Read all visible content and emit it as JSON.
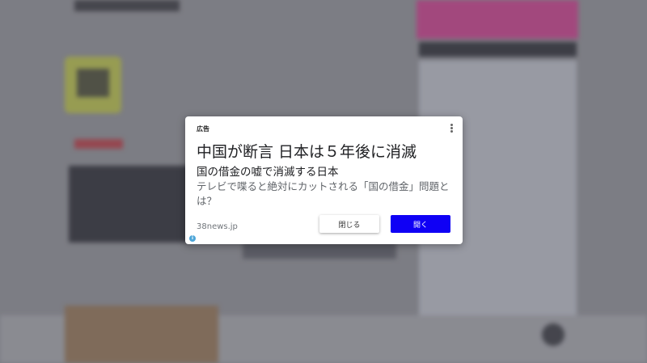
{
  "ad": {
    "label": "広告",
    "headline": "中国が断言 日本は５年後に消滅",
    "subheadline": "国の借金の嘘で消滅する日本",
    "body": "テレビで喋ると絶対にカットされる「国の借金」問題とは？",
    "domain": "38news.jp",
    "close_label": "閉じる",
    "open_label": "開く",
    "adchoices_symbol": "i",
    "menu_icon": "more-vert-icon"
  },
  "colors": {
    "open_button": "#0f00f5",
    "background_overlay": "#5a5a64",
    "adchoices": "#4ea6d8"
  }
}
